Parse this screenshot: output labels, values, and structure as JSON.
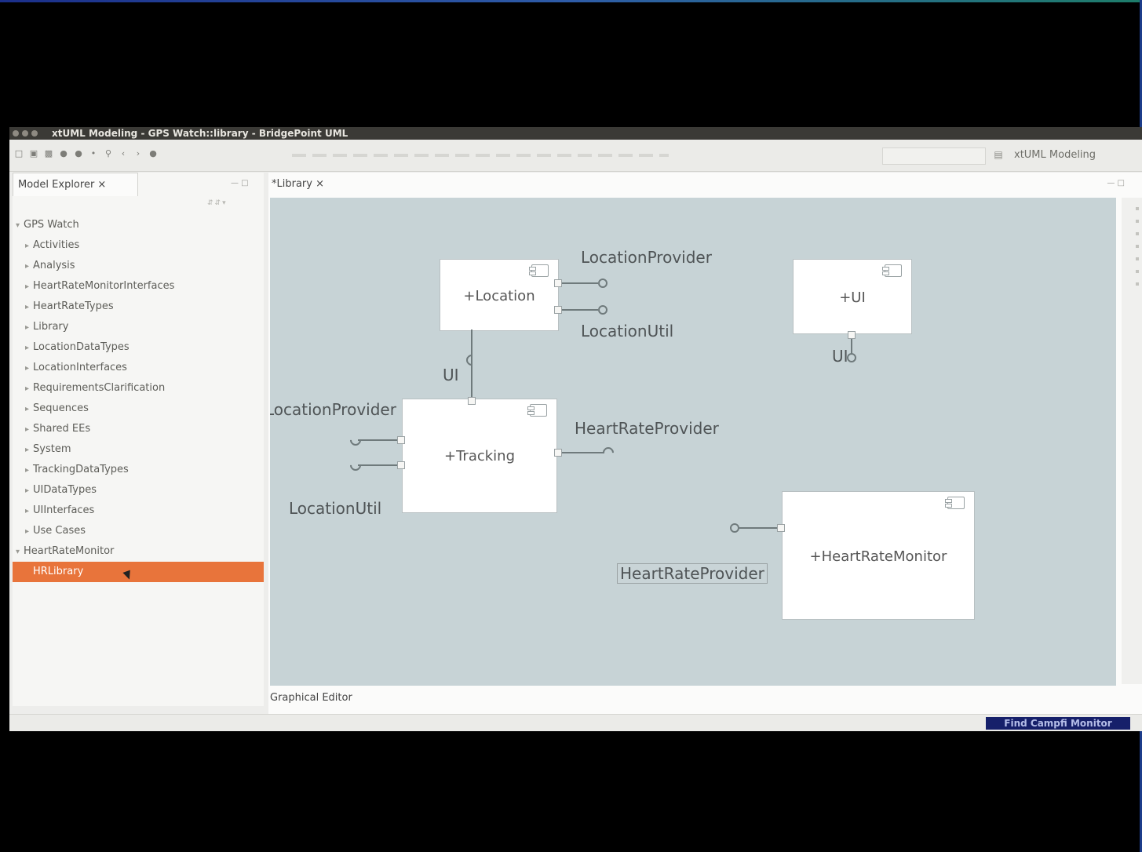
{
  "window": {
    "title": "xtUML Modeling - GPS Watch::library - BridgePoint UML"
  },
  "toolbar": {
    "quick_access": "",
    "perspective_label": "xtUML Modeling"
  },
  "model_explorer": {
    "tab_label": "Model Explorer ×",
    "tree": [
      {
        "label": "GPS Watch",
        "glyph": "▾",
        "indent": 0
      },
      {
        "label": "Activities",
        "glyph": "▸",
        "indent": 1
      },
      {
        "label": "Analysis",
        "glyph": "▸",
        "indent": 1
      },
      {
        "label": "HeartRateMonitorInterfaces",
        "glyph": "▸",
        "indent": 1
      },
      {
        "label": "HeartRateTypes",
        "glyph": "▸",
        "indent": 1
      },
      {
        "label": "Library",
        "glyph": "▸",
        "indent": 1
      },
      {
        "label": "LocationDataTypes",
        "glyph": "▸",
        "indent": 1
      },
      {
        "label": "LocationInterfaces",
        "glyph": "▸",
        "indent": 1
      },
      {
        "label": "RequirementsClarification",
        "glyph": "▸",
        "indent": 1
      },
      {
        "label": "Sequences",
        "glyph": "▸",
        "indent": 1
      },
      {
        "label": "Shared EEs",
        "glyph": "▸",
        "indent": 1
      },
      {
        "label": "System",
        "glyph": "▸",
        "indent": 1
      },
      {
        "label": "TrackingDataTypes",
        "glyph": "▸",
        "indent": 1
      },
      {
        "label": "UIDataTypes",
        "glyph": "▸",
        "indent": 1
      },
      {
        "label": "UIInterfaces",
        "glyph": "▸",
        "indent": 1
      },
      {
        "label": "Use Cases",
        "glyph": "▸",
        "indent": 1
      },
      {
        "label": "HeartRateMonitor",
        "glyph": "▾",
        "indent": 0
      },
      {
        "label": "HRLibrary",
        "glyph": "",
        "indent": 1,
        "selected": true
      }
    ]
  },
  "editor": {
    "tab_label": "*Library ×",
    "bottom_tab": "Graphical Editor"
  },
  "diagram": {
    "components": [
      {
        "id": "location",
        "name": "+Location"
      },
      {
        "id": "ui",
        "name": "+UI"
      },
      {
        "id": "tracking",
        "name": "+Tracking"
      },
      {
        "id": "hrm",
        "name": "+HeartRateMonitor"
      }
    ],
    "labels": {
      "loc_provider": "LocationProvider",
      "loc_util": "LocationUtil",
      "ui_port": "UI",
      "ui_req": "UI",
      "trk_loc_provider": "LocationProvider",
      "trk_loc_util": "LocationUtil",
      "trk_hr_provider": "HeartRateProvider",
      "hrm_hr_provider": "HeartRateProvider"
    }
  },
  "status": {
    "badge": "Find Campfi Monitor"
  }
}
